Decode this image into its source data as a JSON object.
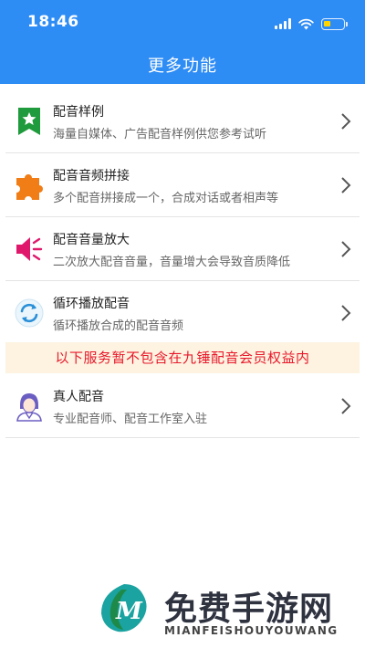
{
  "status_bar": {
    "time": "18:46"
  },
  "header": {
    "title": "更多功能"
  },
  "items": [
    {
      "name": "配音样例",
      "desc": "海量自媒体、广告配音样例供您参考试听",
      "icon": "bookmark-star-icon"
    },
    {
      "name": "配音音频拼接",
      "desc": "多个配音拼接成一个，合成对话或者相声等",
      "icon": "puzzle-icon"
    },
    {
      "name": "配音音量放大",
      "desc": "二次放大配音音量，音量增大会导致音质降低",
      "icon": "speaker-volume-icon"
    },
    {
      "name": "循环播放配音",
      "desc": "循环播放合成的配音音频",
      "icon": "loop-icon"
    }
  ],
  "notice": "以下服务暂不包含在九锤配音会员权益内",
  "items2": [
    {
      "name": "真人配音",
      "desc": "专业配音师、配音工作室入驻",
      "icon": "person-voice-icon"
    }
  ],
  "watermark": {
    "title": "免费手游网",
    "subtitle": "MIANFEISHOUYOUWANG"
  },
  "colors": {
    "header": "#2e8cf5",
    "notice_bg": "#fdf3e0",
    "notice_text": "#e8192c"
  }
}
